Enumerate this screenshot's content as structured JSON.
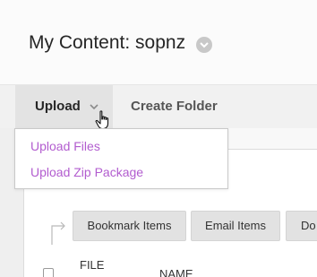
{
  "header": {
    "title": "My Content: sopnz"
  },
  "toolbar": {
    "upload_label": "Upload",
    "create_folder_label": "Create Folder"
  },
  "upload_menu": {
    "items": [
      {
        "label": "Upload Files"
      },
      {
        "label": "Upload Zip Package"
      }
    ]
  },
  "actions": {
    "bookmark_label": "Bookmark Items",
    "email_label": "Email Items",
    "more_label": "Do"
  },
  "table": {
    "columns": [
      "FILE",
      "NAME"
    ]
  },
  "colors": {
    "menu_link": "#b25ccf",
    "button_bg": "#e2e2e2"
  },
  "icons": {
    "title_menu": "chevron-down-icon",
    "upload_menu": "chevron-down-icon",
    "cursor": "hand-pointer-icon",
    "connector": "corner-arrow-icon"
  }
}
